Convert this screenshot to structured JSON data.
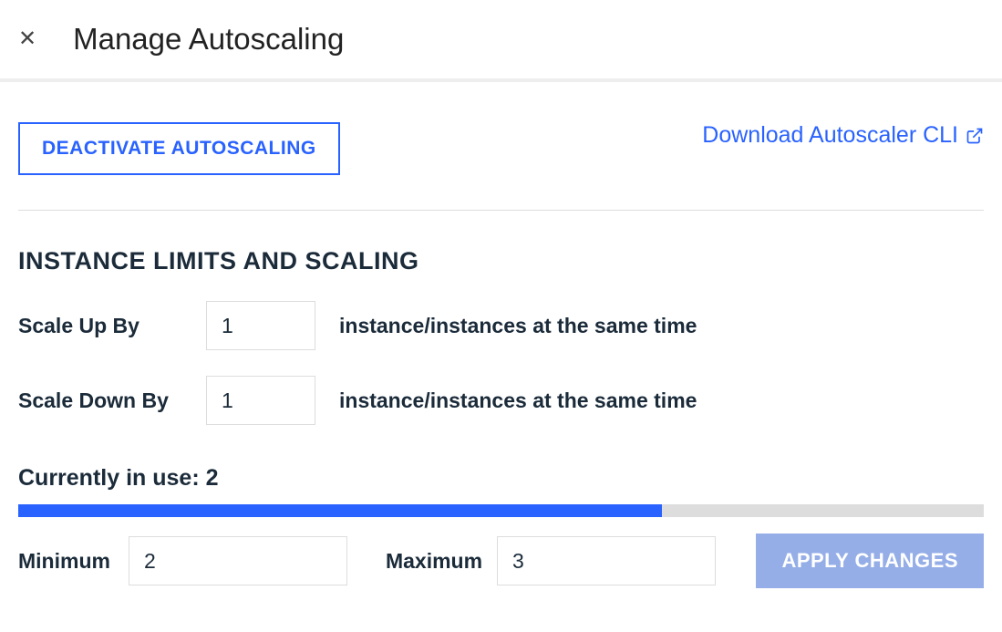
{
  "header": {
    "title": "Manage Autoscaling"
  },
  "actions": {
    "deactivate_label": "DEACTIVATE AUTOSCALING",
    "download_cli_label": "Download Autoscaler CLI",
    "apply_label": "APPLY CHANGES"
  },
  "section": {
    "title": "INSTANCE LIMITS AND SCALING"
  },
  "scale_up": {
    "label": "Scale Up By",
    "value": "1",
    "suffix": "instance/instances at the same time"
  },
  "scale_down": {
    "label": "Scale Down By",
    "value": "1",
    "suffix": "instance/instances at the same time"
  },
  "usage": {
    "label_prefix": "Currently in use: ",
    "value": "2",
    "fill_percent": 66.7
  },
  "limits": {
    "min_label": "Minimum",
    "min_value": "2",
    "max_label": "Maximum",
    "max_value": "3"
  }
}
